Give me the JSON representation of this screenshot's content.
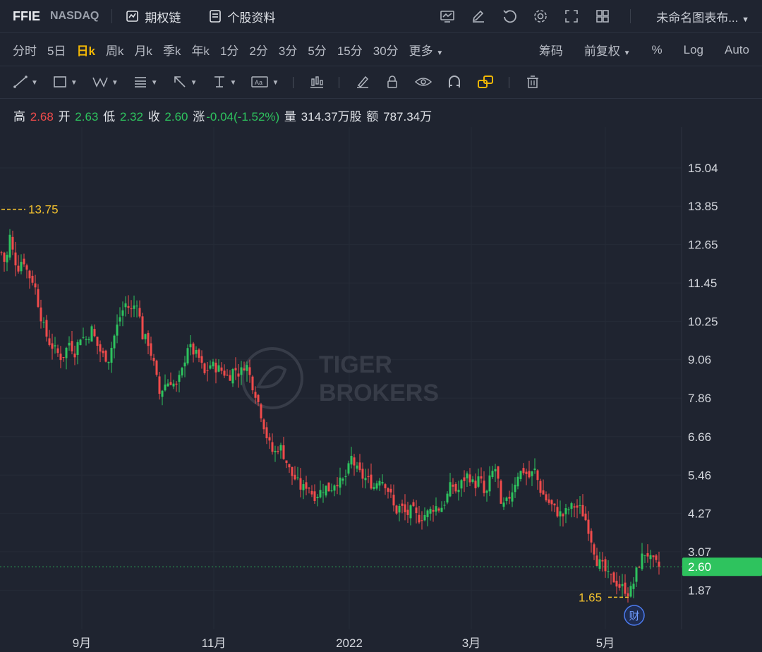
{
  "header": {
    "symbol": "FFIE",
    "exchange": "NASDAQ",
    "options_label": "期权链",
    "profile_label": "个股资料",
    "template_label": "未命名图表布...",
    "tool_icons": [
      "indicator-icon",
      "pen-icon",
      "refresh-icon",
      "gear-icon",
      "fullscreen-icon",
      "layout-grid-icon"
    ]
  },
  "periods": [
    "分时",
    "5日",
    "日k",
    "周k",
    "月k",
    "季k",
    "年k",
    "1分",
    "2分",
    "3分",
    "5分",
    "15分",
    "30分",
    "更多"
  ],
  "active_period": "日k",
  "right_controls": {
    "chips": "筹码",
    "adjust": "前复权",
    "percent": "%",
    "log": "Log",
    "auto": "Auto"
  },
  "quote": {
    "high_label": "高",
    "high": "2.68",
    "open_label": "开",
    "open": "2.63",
    "low_label": "低",
    "low": "2.32",
    "close_label": "收",
    "close": "2.60",
    "change_label": "涨",
    "change": "-0.04(-1.52%)",
    "volume_label": "量",
    "volume": "314.37万股",
    "amount_label": "额",
    "amount": "787.34万"
  },
  "watermark": {
    "line1": "TIGER",
    "line2": "BROKERS"
  },
  "chart_data": {
    "type": "candlestick",
    "y_ticks": [
      "15.04",
      "13.85",
      "12.65",
      "11.45",
      "10.25",
      "9.06",
      "7.86",
      "6.66",
      "5.46",
      "4.27",
      "3.07",
      "1.87"
    ],
    "y_range": [
      1.0,
      16.0
    ],
    "x_labels": [
      "9月",
      "11月",
      "2022",
      "3月",
      "5月"
    ],
    "current_price": "2.60",
    "max_marker": {
      "label": "13.75",
      "value": 13.75
    },
    "min_marker": {
      "label": "1.65",
      "value": 1.65
    },
    "event_badge": "财",
    "close_path": [
      [
        0,
        12.4
      ],
      [
        6,
        12.0
      ],
      [
        12,
        12.9
      ],
      [
        18,
        12.2
      ],
      [
        25,
        11.9
      ],
      [
        30,
        12.3
      ],
      [
        38,
        11.7
      ],
      [
        46,
        11.5
      ],
      [
        55,
        10.5
      ],
      [
        62,
        9.9
      ],
      [
        68,
        9.6
      ],
      [
        78,
        9.3
      ],
      [
        86,
        9.1
      ],
      [
        96,
        9.6
      ],
      [
        104,
        9.3
      ],
      [
        112,
        9.8
      ],
      [
        120,
        9.7
      ],
      [
        128,
        10.0
      ],
      [
        136,
        9.5
      ],
      [
        143,
        9.2
      ],
      [
        152,
        9.1
      ],
      [
        160,
        9.8
      ],
      [
        168,
        10.4
      ],
      [
        176,
        10.8
      ],
      [
        184,
        10.6
      ],
      [
        192,
        10.9
      ],
      [
        200,
        9.8
      ],
      [
        208,
        9.6
      ],
      [
        216,
        8.9
      ],
      [
        224,
        8.0
      ],
      [
        232,
        8.3
      ],
      [
        240,
        8.4
      ],
      [
        248,
        8.2
      ],
      [
        256,
        8.7
      ],
      [
        264,
        9.5
      ],
      [
        272,
        9.3
      ],
      [
        280,
        9.1
      ],
      [
        288,
        8.6
      ],
      [
        296,
        8.9
      ],
      [
        306,
        8.8
      ],
      [
        314,
        8.7
      ],
      [
        322,
        8.5
      ],
      [
        330,
        8.8
      ],
      [
        338,
        8.6
      ],
      [
        346,
        9.0
      ],
      [
        354,
        8.4
      ],
      [
        362,
        7.9
      ],
      [
        370,
        7.2
      ],
      [
        378,
        6.5
      ],
      [
        386,
        6.1
      ],
      [
        394,
        6.4
      ],
      [
        402,
        6.0
      ],
      [
        410,
        5.5
      ],
      [
        418,
        5.3
      ],
      [
        426,
        5.0
      ],
      [
        434,
        5.2
      ],
      [
        442,
        4.8
      ],
      [
        450,
        4.9
      ],
      [
        458,
        5.1
      ],
      [
        466,
        5.0
      ],
      [
        474,
        5.3
      ],
      [
        482,
        5.2
      ],
      [
        490,
        5.5
      ],
      [
        496,
        6.0
      ],
      [
        504,
        5.6
      ],
      [
        512,
        5.4
      ],
      [
        520,
        5.3
      ],
      [
        528,
        5.1
      ],
      [
        536,
        5.4
      ],
      [
        544,
        5.2
      ],
      [
        552,
        4.8
      ],
      [
        558,
        4.3
      ],
      [
        566,
        4.5
      ],
      [
        574,
        4.2
      ],
      [
        582,
        4.4
      ],
      [
        590,
        4.1
      ],
      [
        598,
        4.2
      ],
      [
        606,
        4.3
      ],
      [
        614,
        4.5
      ],
      [
        622,
        4.4
      ],
      [
        630,
        4.7
      ],
      [
        638,
        5.2
      ],
      [
        646,
        4.9
      ],
      [
        654,
        5.3
      ],
      [
        662,
        5.5
      ],
      [
        670,
        5.1
      ],
      [
        678,
        5.4
      ],
      [
        686,
        4.7
      ],
      [
        694,
        5.5
      ],
      [
        702,
        5.7
      ],
      [
        708,
        4.4
      ],
      [
        716,
        4.6
      ],
      [
        724,
        5.0
      ],
      [
        732,
        5.5
      ],
      [
        740,
        5.6
      ],
      [
        748,
        5.4
      ],
      [
        756,
        5.6
      ],
      [
        764,
        5.0
      ],
      [
        772,
        4.7
      ],
      [
        780,
        4.5
      ],
      [
        788,
        4.3
      ],
      [
        796,
        4.2
      ],
      [
        804,
        4.4
      ],
      [
        812,
        4.5
      ],
      [
        820,
        4.4
      ],
      [
        826,
        4.2
      ],
      [
        832,
        3.8
      ],
      [
        838,
        3.3
      ],
      [
        844,
        2.8
      ],
      [
        852,
        2.6
      ],
      [
        860,
        2.3
      ],
      [
        868,
        2.2
      ],
      [
        876,
        2.0
      ],
      [
        884,
        1.9
      ],
      [
        890,
        1.75
      ],
      [
        896,
        2.1
      ],
      [
        902,
        2.6
      ],
      [
        908,
        2.9
      ],
      [
        914,
        3.1
      ],
      [
        920,
        2.8
      ],
      [
        926,
        2.7
      ],
      [
        932,
        2.6
      ]
    ]
  },
  "colors": {
    "up": "#2ec35e",
    "down": "#f04b4b",
    "marker": "#f2c12e",
    "price_tag": "#2ec35e",
    "active": "#f2b705"
  }
}
